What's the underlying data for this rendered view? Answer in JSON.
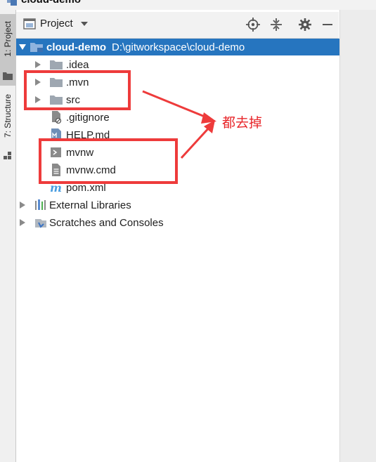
{
  "window": {
    "title": "cloud-demo"
  },
  "left_strip": {
    "tabs": [
      {
        "label": "1: Project"
      },
      {
        "label": "7: Structure"
      }
    ]
  },
  "panel": {
    "title": "Project",
    "icons": [
      "locate-icon",
      "collapse-all-icon",
      "gear-icon",
      "minimize-icon"
    ]
  },
  "tree": {
    "root": {
      "label": "cloud-demo",
      "path": "D:\\gitworkspace\\cloud-demo"
    },
    "children": [
      {
        "label": ".idea",
        "type": "folder"
      },
      {
        "label": ".mvn",
        "type": "folder"
      },
      {
        "label": "src",
        "type": "folder"
      },
      {
        "label": ".gitignore",
        "type": "file-ignore"
      },
      {
        "label": "HELP.md",
        "type": "file-md"
      },
      {
        "label": "mvnw",
        "type": "file-shell"
      },
      {
        "label": "mvnw.cmd",
        "type": "file-text"
      },
      {
        "label": "pom.xml",
        "type": "file-maven"
      }
    ],
    "external_libraries": "External Libraries",
    "scratches": "Scratches and Consoles"
  },
  "annotation": {
    "text": "都去掉",
    "color": "#e8262a"
  }
}
